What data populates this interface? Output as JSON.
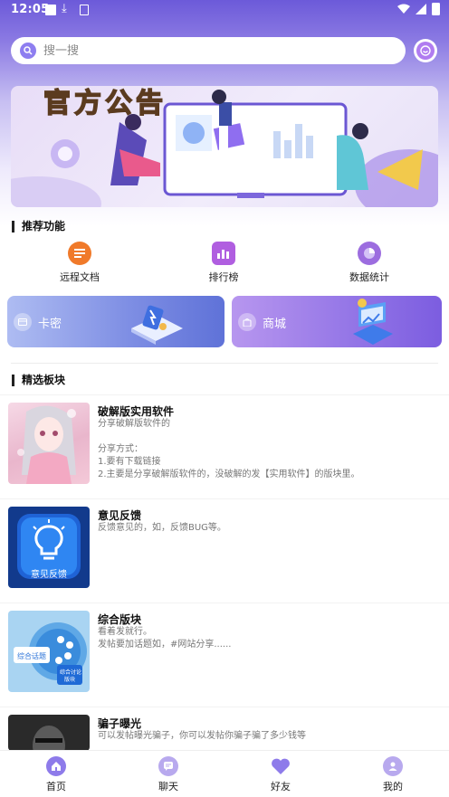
{
  "status": {
    "time": "12:05"
  },
  "search": {
    "placeholder": "搜一搜"
  },
  "banner": {
    "title": "官方公告"
  },
  "sections": {
    "recommend": "推荐功能",
    "featured": "精选板块"
  },
  "functions": [
    {
      "label": "远程文档",
      "icon": "document-icon",
      "color": "#f07a2a"
    },
    {
      "label": "排行榜",
      "icon": "bar-chart-icon",
      "color": "#b05ee0"
    },
    {
      "label": "数据统计",
      "icon": "pie-chart-icon",
      "color": "#9c6ddf"
    }
  ],
  "cards": [
    {
      "label": "卡密",
      "icon": "card-icon",
      "color": "#7a8ee8"
    },
    {
      "label": "商城",
      "icon": "shop-bag-icon",
      "color": "#9b78e8"
    }
  ],
  "posts": [
    {
      "title": "破解版实用软件",
      "desc": "分享破解版软件的\n\n分享方式：\n1.要有下载链接\n2.主要是分享破解版软件的，没破解的发【实用软件】的版块里。"
    },
    {
      "title": "意见反馈",
      "desc": "反馈意见的，如，反馈BUG等。",
      "thumb_text": "意见反馈"
    },
    {
      "title": "综合版块",
      "desc": "看着发就行。\n发帖要加话题如，#网站分享......",
      "thumb_text": [
        "综合话题",
        "综合讨论",
        "版块"
      ]
    },
    {
      "title": "骗子曝光",
      "desc": "可以发帖曝光骗子，你可以发帖你骗子骗了多少钱等"
    }
  ],
  "tabs": [
    {
      "label": "首页",
      "icon": "home-icon",
      "active": true
    },
    {
      "label": "聊天",
      "icon": "chat-icon",
      "active": false
    },
    {
      "label": "好友",
      "icon": "heart-icon",
      "active": false
    },
    {
      "label": "我的",
      "icon": "profile-icon",
      "active": false
    }
  ],
  "colors": {
    "accent": "#7b68e6",
    "header_top": "#6c5ad9"
  }
}
